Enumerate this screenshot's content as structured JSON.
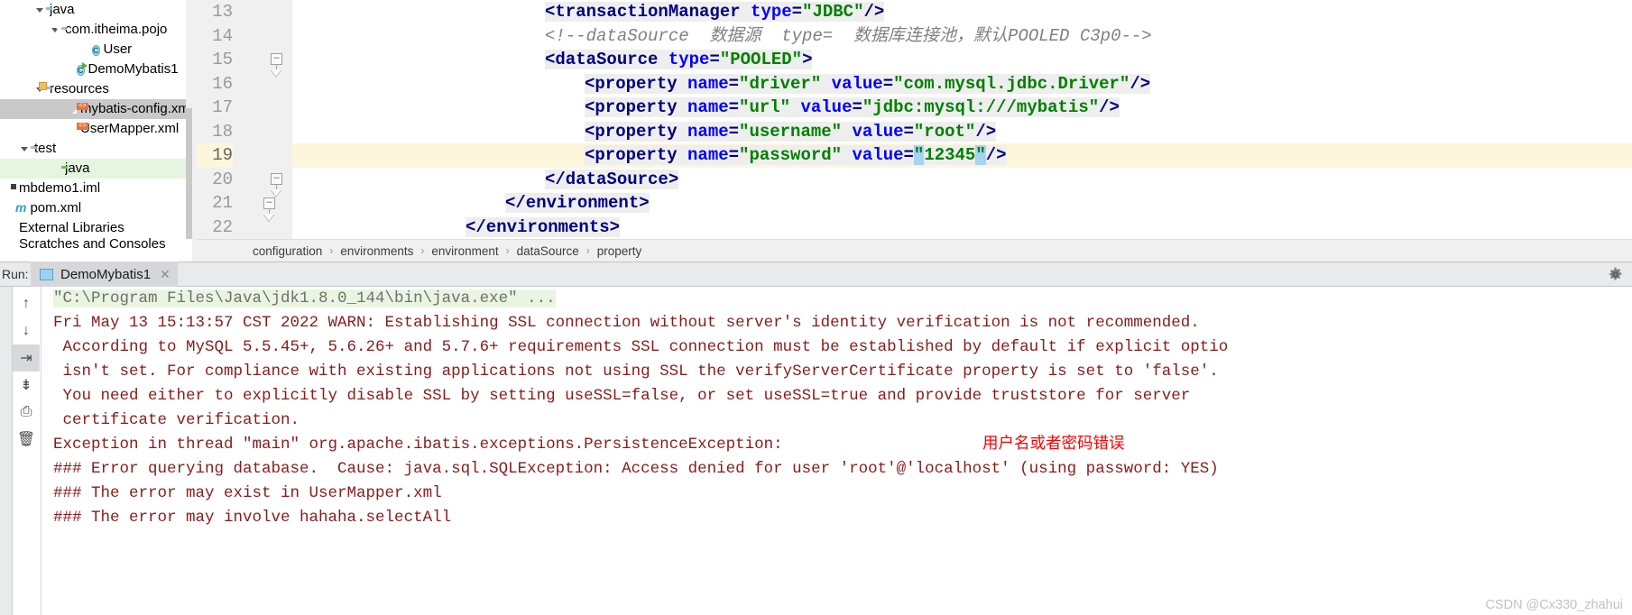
{
  "project_tree": {
    "items": [
      {
        "label": "java",
        "indent": 2,
        "icon": "folder-blue-icon",
        "arrow": "open",
        "state": "none"
      },
      {
        "label": "com.itheima.pojo",
        "indent": 3,
        "icon": "package-folder-icon",
        "arrow": "open",
        "state": "none"
      },
      {
        "label": "User",
        "indent": 5,
        "icon": "java-class-icon",
        "arrow": "none",
        "state": "none"
      },
      {
        "label": "DemoMybatis1",
        "indent": 4,
        "icon": "java-runnable-class-icon",
        "arrow": "none",
        "state": "none"
      },
      {
        "label": "resources",
        "indent": 2,
        "icon": "resources-folder-icon",
        "arrow": "open",
        "state": "none"
      },
      {
        "label": "mybatis-config.xml",
        "indent": 4,
        "icon": "xml-file-icon",
        "arrow": "none",
        "state": "selected"
      },
      {
        "label": "UserMapper.xml",
        "indent": 4,
        "icon": "xml-file-icon",
        "arrow": "none",
        "state": "none"
      },
      {
        "label": "test",
        "indent": 1,
        "icon": "folder-grey-icon",
        "arrow": "open",
        "state": "none"
      },
      {
        "label": "java",
        "indent": 3,
        "icon": "folder-green-icon",
        "arrow": "none",
        "state": "green"
      },
      {
        "label": "mbdemo1.iml",
        "indent": 0,
        "icon": "iml-file-icon",
        "arrow": "none",
        "state": "none"
      },
      {
        "label": "pom.xml",
        "indent": 0,
        "icon": "maven-icon",
        "arrow": "none",
        "state": "none"
      },
      {
        "label": "External Libraries",
        "indent": 0,
        "icon": "library-icon",
        "arrow": "none",
        "state": "none"
      },
      {
        "label": "Scratches and Consoles",
        "indent": 0,
        "icon": "library-icon",
        "arrow": "none",
        "state": "clipped"
      }
    ]
  },
  "editor": {
    "line_numbers": [
      "13",
      "14",
      "15",
      "16",
      "17",
      "18",
      "19",
      "20",
      "21",
      "22"
    ],
    "current_line": "19",
    "lines": [
      {
        "num": "13",
        "indent": 1,
        "parts": [
          {
            "t": "tag",
            "s": "<transactionManager "
          },
          {
            "t": "attr",
            "s": "type"
          },
          {
            "t": "eq",
            "s": "="
          },
          {
            "t": "val",
            "s": "\"JDBC\""
          },
          {
            "t": "tag",
            "s": "/>"
          }
        ]
      },
      {
        "num": "14",
        "indent": 1,
        "parts": [
          {
            "t": "comment",
            "s": "<!--dataSource  数据源  type=  数据库连接池，默认POOLED C3p0-->"
          }
        ]
      },
      {
        "num": "15",
        "indent": 1,
        "parts": [
          {
            "t": "tag",
            "s": "<dataSource "
          },
          {
            "t": "attr",
            "s": "type"
          },
          {
            "t": "eq",
            "s": "="
          },
          {
            "t": "val",
            "s": "\"POOLED\""
          },
          {
            "t": "tag",
            "s": ">"
          }
        ]
      },
      {
        "num": "16",
        "indent": 2,
        "parts": [
          {
            "t": "tag",
            "s": "<property "
          },
          {
            "t": "attr",
            "s": "name"
          },
          {
            "t": "eq",
            "s": "="
          },
          {
            "t": "val",
            "s": "\"driver\""
          },
          {
            "t": "plain",
            "s": " "
          },
          {
            "t": "attr",
            "s": "value"
          },
          {
            "t": "eq",
            "s": "="
          },
          {
            "t": "val",
            "s": "\"com.mysql.jdbc.Driver\""
          },
          {
            "t": "tag",
            "s": "/>"
          }
        ]
      },
      {
        "num": "17",
        "indent": 2,
        "parts": [
          {
            "t": "tag",
            "s": "<property "
          },
          {
            "t": "attr",
            "s": "name"
          },
          {
            "t": "eq",
            "s": "="
          },
          {
            "t": "val",
            "s": "\"url\""
          },
          {
            "t": "plain",
            "s": " "
          },
          {
            "t": "attr",
            "s": "value"
          },
          {
            "t": "eq",
            "s": "="
          },
          {
            "t": "val",
            "s": "\"jdbc:mysql:///mybatis\""
          },
          {
            "t": "tag",
            "s": "/>"
          }
        ]
      },
      {
        "num": "18",
        "indent": 2,
        "parts": [
          {
            "t": "tag",
            "s": "<property "
          },
          {
            "t": "attr",
            "s": "name"
          },
          {
            "t": "eq",
            "s": "="
          },
          {
            "t": "val",
            "s": "\"username\""
          },
          {
            "t": "plain",
            "s": " "
          },
          {
            "t": "attr",
            "s": "value"
          },
          {
            "t": "eq",
            "s": "="
          },
          {
            "t": "val",
            "s": "\"root\""
          },
          {
            "t": "tag",
            "s": "/>"
          }
        ]
      },
      {
        "num": "19",
        "indent": 2,
        "parts": [
          {
            "t": "tag",
            "s": "<property "
          },
          {
            "t": "attr",
            "s": "name"
          },
          {
            "t": "eq",
            "s": "="
          },
          {
            "t": "val",
            "s": "\"password\""
          },
          {
            "t": "plain",
            "s": " "
          },
          {
            "t": "attr",
            "s": "value"
          },
          {
            "t": "eq",
            "s": "="
          },
          {
            "t": "sel",
            "s": "\""
          },
          {
            "t": "val",
            "s": "12345"
          },
          {
            "t": "sel",
            "s": "\""
          },
          {
            "t": "tag",
            "s": "/>"
          }
        ]
      },
      {
        "num": "20",
        "indent": 1,
        "parts": [
          {
            "t": "tag",
            "s": "</dataSource>"
          }
        ]
      },
      {
        "num": "21",
        "indent": 0,
        "parts": [
          {
            "t": "tag",
            "s": "</environment>"
          }
        ]
      },
      {
        "num": "22",
        "indent": -1,
        "parts": [
          {
            "t": "tag",
            "s": "</environments>"
          }
        ]
      }
    ]
  },
  "breadcrumb": {
    "items": [
      "configuration",
      "environments",
      "environment",
      "dataSource",
      "property"
    ],
    "separator": "›"
  },
  "run_window": {
    "label": "Run:",
    "tab_title": "DemoMybatis1",
    "close_glyph": "✕",
    "gear_icon": "gear-icon",
    "toolbar": [
      {
        "name": "up-arrow-icon",
        "glyph": "↑",
        "active": false
      },
      {
        "name": "down-arrow-icon",
        "glyph": "↓",
        "active": false
      },
      {
        "name": "soft-wrap-icon",
        "glyph": "⇥",
        "active": true
      },
      {
        "name": "scroll-to-end-icon",
        "glyph": "⇟",
        "active": false
      },
      {
        "name": "print-icon",
        "glyph": "⎙",
        "active": false
      },
      {
        "name": "trash-icon",
        "glyph": "🗑",
        "active": false
      }
    ],
    "console_lines": [
      {
        "text": "\"C:\\Program Files\\Java\\jdk1.8.0_144\\bin\\java.exe\" ...",
        "style": "cmd"
      },
      {
        "text": "Fri May 13 15:13:57 CST 2022 WARN: Establishing SSL connection without server's identity verification is not recommended.",
        "style": "err"
      },
      {
        "text": " According to MySQL 5.5.45+, 5.6.26+ and 5.7.6+ requirements SSL connection must be established by default if explicit optio",
        "style": "err"
      },
      {
        "text": " isn't set. For compliance with existing applications not using SSL the verifyServerCertificate property is set to 'false'.",
        "style": "err"
      },
      {
        "text": " You need either to explicitly disable SSL by setting useSSL=false, or set useSSL=true and provide truststore for server",
        "style": "err"
      },
      {
        "text": " certificate verification.",
        "style": "err"
      },
      {
        "text": "Exception in thread \"main\" org.apache.ibatis.exceptions.PersistenceException:",
        "style": "err"
      },
      {
        "text": "### Error querying database.  Cause: java.sql.SQLException: Access denied for user 'root'@'localhost' (using password: YES)",
        "style": "err"
      },
      {
        "text": "### The error may exist in UserMapper.xml",
        "style": "err"
      },
      {
        "text": "### The error may involve hahaha.selectAll",
        "style": "err"
      }
    ],
    "annotation": "用户名或者密码错误"
  },
  "watermark": "CSDN @Cx330_zhahui"
}
